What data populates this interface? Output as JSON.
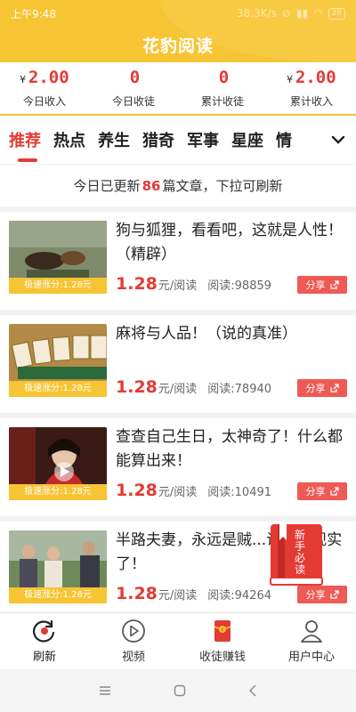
{
  "status": {
    "time": "上午9:48",
    "speed": "38.3K/s",
    "battery": "38"
  },
  "app": {
    "title": "花豹阅读"
  },
  "stats": [
    {
      "currency": "¥",
      "value": "2.00",
      "label": "今日收入"
    },
    {
      "currency": "",
      "value": "0",
      "label": "今日收徒"
    },
    {
      "currency": "",
      "value": "0",
      "label": "累计收徒"
    },
    {
      "currency": "¥",
      "value": "2.00",
      "label": "累计收入"
    }
  ],
  "tabs": [
    "推荐",
    "热点",
    "养生",
    "猎奇",
    "军事",
    "星座",
    "情"
  ],
  "notice": {
    "prefix": "今日已更新",
    "count": "86",
    "suffix": "篇文章，下拉可刷新"
  },
  "articles": [
    {
      "title": "狗与狐狸，看看吧，这就是人性！（精辟）",
      "badge": "极速涨分:1.28元",
      "price": "1.28",
      "unit": "元/阅读",
      "reads": "阅读:98859",
      "share": "分享"
    },
    {
      "title": "麻将与人品！（说的真准）",
      "badge": "极速涨分:1.28元",
      "price": "1.28",
      "unit": "元/阅读",
      "reads": "阅读:78940",
      "share": "分享"
    },
    {
      "title": "查查自己生日，太神奇了！什么都能算出来！",
      "badge": "极速涨分:1.28元",
      "price": "1.28",
      "unit": "元/阅读",
      "reads": "阅读:10491",
      "share": "分享"
    },
    {
      "title": "半路夫妻，永远是贼...说的太现实了！",
      "badge": "极速涨分:1.28元",
      "price": "1.28",
      "unit": "元/阅读",
      "reads": "阅读:94264",
      "share": "分享"
    }
  ],
  "floating": {
    "text": "新手必读"
  },
  "nav": [
    {
      "label": "刷新"
    },
    {
      "label": "视频"
    },
    {
      "label": "收徒赚钱"
    },
    {
      "label": "用户中心"
    }
  ],
  "colors": {
    "brand": "#f7c433",
    "accent": "#e33b34",
    "share": "#ee5a55"
  }
}
